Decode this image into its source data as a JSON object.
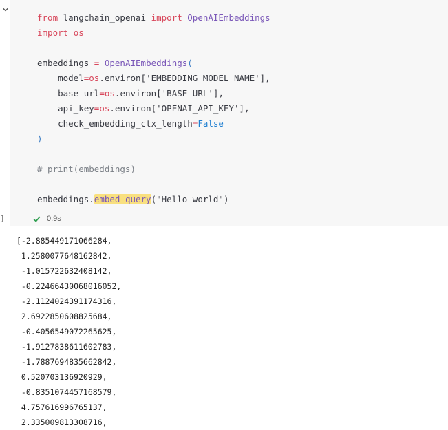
{
  "cell": {
    "code_tokens": {
      "from_kw": "from",
      "module": "langchain_openai",
      "import_kw": "import",
      "class_name": "OpenAIEmbeddings",
      "import_kw2": "import",
      "os_module": "os",
      "var_embeddings": "embeddings",
      "assign": "=",
      "ctor": "OpenAIEmbeddings",
      "open_paren": "(",
      "arg1_name": "model",
      "arg1_os": "os",
      "arg1_environ": ".environ[",
      "arg1_key": "'EMBEDDING_MODEL_NAME'",
      "arg1_close": "],",
      "arg2_name": "base_url",
      "arg2_os": "os",
      "arg2_environ": ".environ[",
      "arg2_key": "'BASE_URL'",
      "arg2_close": "],",
      "arg3_name": "api_key",
      "arg3_os": "os",
      "arg3_environ": ".environ[",
      "arg3_key": "'OPENAI_API_KEY'",
      "arg3_close": "],",
      "arg4_name": "check_embedding_ctx_length",
      "arg4_value": "False",
      "close_paren": ")",
      "comment": "# print(embeddings)",
      "call_obj": "embeddings.",
      "call_method": "embed_query",
      "call_args": "(\"Hello world\")"
    },
    "exec_bracket": "]",
    "status": {
      "duration": "0.9s"
    }
  },
  "output": {
    "lines": [
      "[-2.885449171066284,",
      " 1.2580077648162842,",
      " -1.015722632408142,",
      " -0.22466430068016052,",
      " -2.1124024391174316,",
      " 2.6922850608825684,",
      " -0.4056549072265625,",
      " -1.9127838611602783,",
      " -1.7887694835662842,",
      " 0.520703136920929,",
      " -0.8351074457168579,",
      " 4.757616996765137,",
      " 2.335009813308716,"
    ]
  },
  "colors": {
    "keyword": "#d8475b",
    "function": "#7a57b8",
    "boolean": "#1f7fd1",
    "comment": "#7a7f86",
    "highlight": "#f9e07f",
    "success": "#2e9e4f",
    "cell_background": "#f7f7f7"
  },
  "icons": {
    "collapse": "chevron-down-icon",
    "status": "check-icon"
  }
}
